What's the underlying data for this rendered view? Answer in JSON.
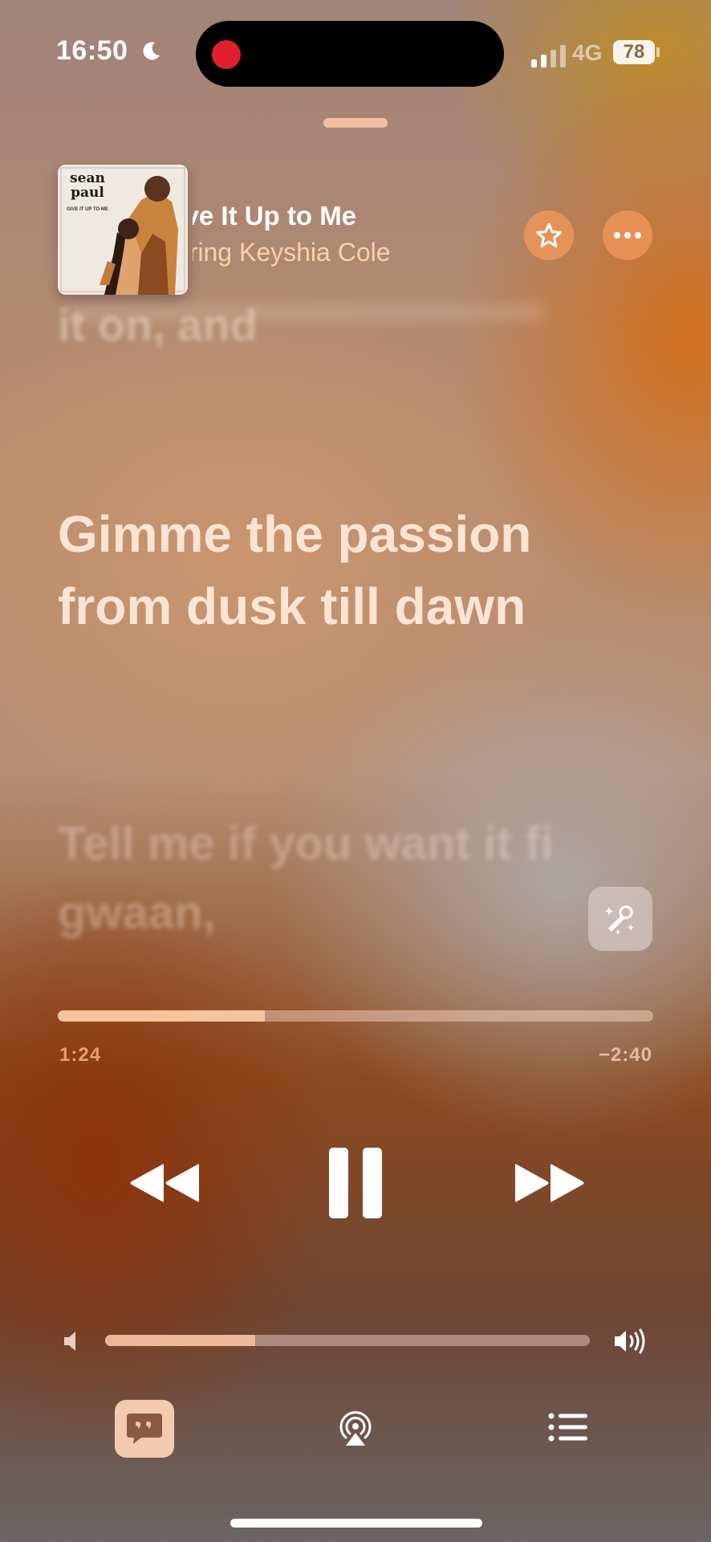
{
  "status_bar": {
    "time": "16:50",
    "network": "4G",
    "battery": "78",
    "icons": [
      "moon-icon",
      "screen-recording-indicator",
      "cellular-signal-icon",
      "battery-icon"
    ]
  },
  "now_playing": {
    "title": "(You Gonna) Give It Up to Me",
    "artist": "Sean Paul featuring Keyshia Cole",
    "artwork": {
      "brand_text": "sean paul",
      "tagline": "GIVE IT UP TO ME"
    },
    "icons": [
      "star-icon",
      "more-icon"
    ]
  },
  "lyrics": {
    "previous_line": "it on, and",
    "current_line": "Gimme the passion from dusk till dawn",
    "next_line": "Tell me if you want it fi gwaan,"
  },
  "playback": {
    "elapsed": "1:24",
    "remaining": "−2:40",
    "progress_fraction": 0.348
  },
  "volume": {
    "level_fraction": 0.31
  },
  "toolbar": {
    "icons": [
      "lyrics-icon",
      "airplay-icon",
      "queue-icon"
    ]
  },
  "colors": {
    "accent_text": "#fbe4d4",
    "artist_text": "#ffd2af",
    "progress_fill": "#f5c49d",
    "record_dot": "#e0202c"
  }
}
